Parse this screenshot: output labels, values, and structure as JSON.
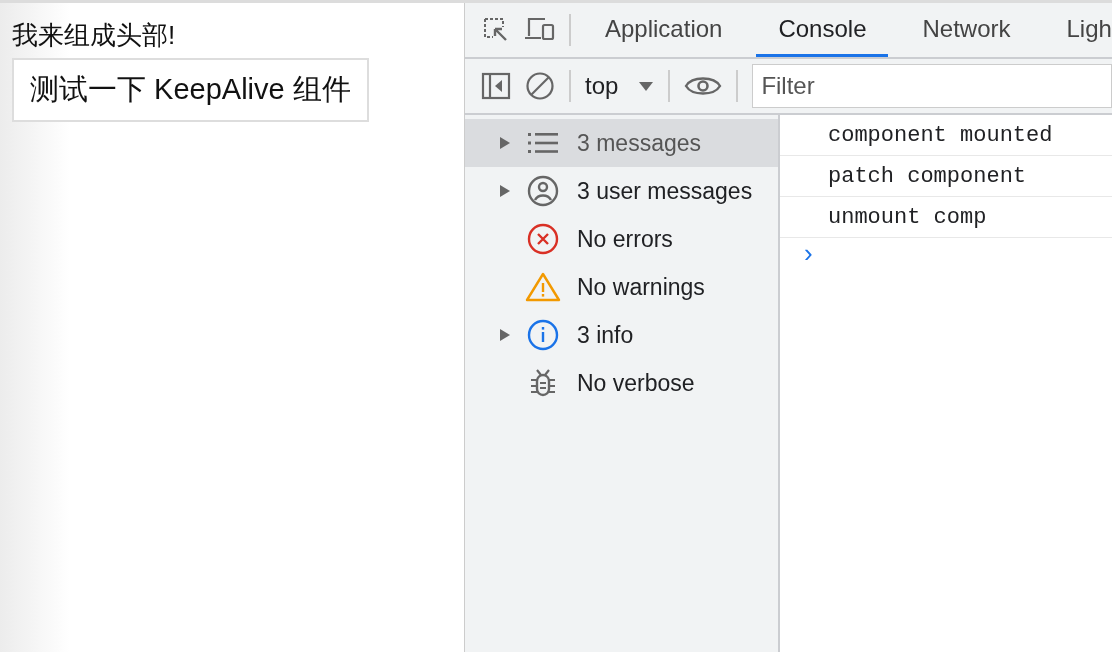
{
  "page": {
    "heading": "我来组成头部!",
    "button": "测试一下 KeepAlive 组件"
  },
  "devtools": {
    "tabs": [
      {
        "label": "Application",
        "selected": false
      },
      {
        "label": "Console",
        "selected": true
      },
      {
        "label": "Network",
        "selected": false
      },
      {
        "label": "Ligh",
        "selected": false
      }
    ],
    "toolbar": {
      "context": "top",
      "filter": {
        "placeholder": "Filter"
      }
    },
    "sidebar": {
      "items": [
        {
          "kind": "list",
          "label": "3 messages",
          "expandable": true,
          "selected": true
        },
        {
          "kind": "user",
          "label": "3 user messages",
          "expandable": true,
          "selected": false
        },
        {
          "kind": "error",
          "label": "No errors",
          "expandable": false,
          "selected": false
        },
        {
          "kind": "warning",
          "label": "No warnings",
          "expandable": false,
          "selected": false
        },
        {
          "kind": "info",
          "label": "3 info",
          "expandable": true,
          "selected": false
        },
        {
          "kind": "verbose",
          "label": "No verbose",
          "expandable": false,
          "selected": false
        }
      ]
    },
    "console": {
      "messages": [
        "component mounted",
        "patch component",
        "unmount comp"
      ],
      "prompt": "›"
    }
  }
}
